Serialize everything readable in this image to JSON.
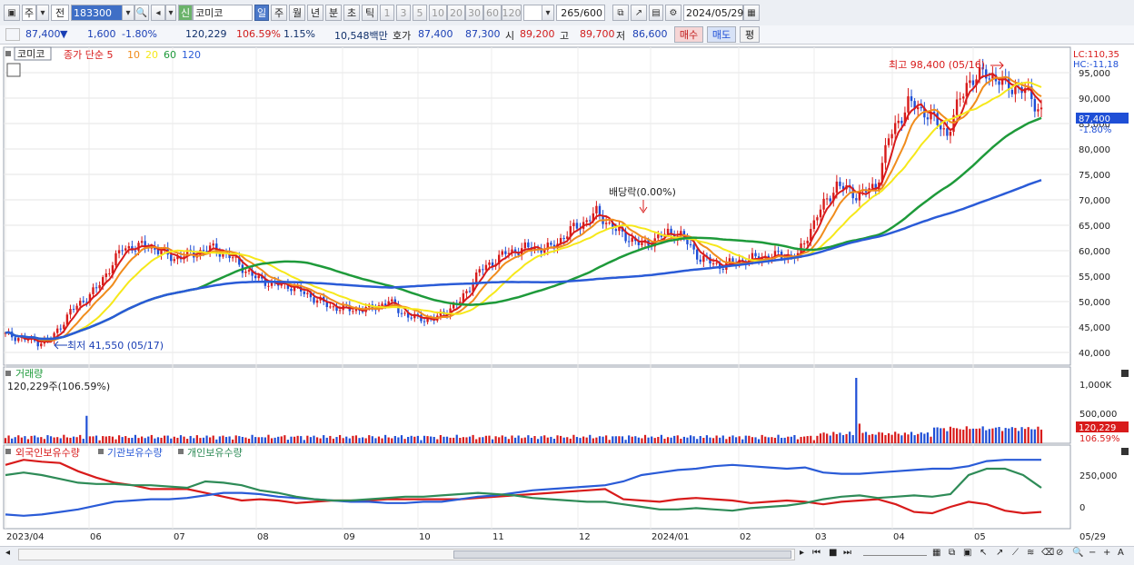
{
  "toolbar": {
    "chart_type": "주",
    "compare": "전",
    "code": "183300",
    "badge": "신",
    "name": "코미코",
    "periods": [
      "일",
      "주",
      "월",
      "년",
      "분",
      "초",
      "틱"
    ],
    "intervals": [
      "1",
      "3",
      "5",
      "10",
      "20",
      "30",
      "60",
      "120"
    ],
    "count_value": "265",
    "count_max": "/600",
    "date": "2024/05/29"
  },
  "quote": {
    "price": "87,400",
    "change": "1,600",
    "change_pct": "-1.80%",
    "volume": "120,229",
    "volume_ratio": "106.59%",
    "turnover": "1.15%",
    "amount": "10,548백만",
    "ask_label": "호가",
    "ask": "87,400",
    "bid": "87,300",
    "open_label": "시",
    "open": "89,200",
    "high_label": "고",
    "high": "89,700",
    "low_label": "저",
    "low": "86,600",
    "buy": "매수",
    "sell": "매도",
    "eval": "평"
  },
  "colors": {
    "ma5": "#d81b1b",
    "ma10": "#f08c1c",
    "ma20": "#f6e81a",
    "ma60": "#1e9a3a",
    "ma120": "#2a5bd7",
    "up": "#d81b1b",
    "down": "#1f4fd6",
    "foreign": "#d81b1b",
    "inst": "#2a5bd7",
    "indiv": "#2e8b57"
  },
  "chart_data": [
    {
      "type": "candlestick",
      "legend_name": "코미코",
      "legend_series": [
        "종가 단순 5",
        "10",
        "20",
        "60",
        "120"
      ],
      "price_labels": [
        "95,000",
        "90,000",
        "85,000",
        "80,000",
        "75,000",
        "70,000",
        "65,000",
        "60,000",
        "55,000",
        "50,000",
        "45,000",
        "40,000"
      ],
      "price_ticks": [
        95000,
        90000,
        85000,
        80000,
        75000,
        70000,
        65000,
        60000,
        55000,
        50000,
        45000,
        40000
      ],
      "ylim": [
        37500,
        100000
      ],
      "lc": "LC:110,35",
      "hc": "HC:-11,18",
      "current_price": "87,400",
      "current_pct": "-1.80%",
      "annotation_high": "최고 98,400 (05/16)",
      "annotation_low": "최저 41,550 (05/17)",
      "annotation_dividend": "배당락(0.00%)",
      "close_keypoints": [
        [
          0,
          43500
        ],
        [
          10,
          42000
        ],
        [
          14,
          42500
        ],
        [
          20,
          48000
        ],
        [
          28,
          52500
        ],
        [
          36,
          60500
        ],
        [
          44,
          61000
        ],
        [
          52,
          58500
        ],
        [
          58,
          59500
        ],
        [
          64,
          60500
        ],
        [
          70,
          58500
        ],
        [
          76,
          55000
        ],
        [
          82,
          53500
        ],
        [
          88,
          53000
        ],
        [
          94,
          51000
        ],
        [
          100,
          49000
        ],
        [
          106,
          48500
        ],
        [
          112,
          48500
        ],
        [
          118,
          50000
        ],
        [
          124,
          47000
        ],
        [
          132,
          46500
        ],
        [
          140,
          50000
        ],
        [
          146,
          56000
        ],
        [
          154,
          59500
        ],
        [
          160,
          60500
        ],
        [
          168,
          60500
        ],
        [
          174,
          64000
        ],
        [
          178,
          65500
        ],
        [
          182,
          67500
        ],
        [
          188,
          64000
        ],
        [
          196,
          61000
        ],
        [
          204,
          63500
        ],
        [
          208,
          63000
        ],
        [
          214,
          58500
        ],
        [
          220,
          57000
        ],
        [
          226,
          58000
        ],
        [
          236,
          59000
        ],
        [
          244,
          59000
        ],
        [
          250,
          67000
        ],
        [
          256,
          73000
        ],
        [
          262,
          71000
        ],
        [
          268,
          72500
        ],
        [
          272,
          82000
        ],
        [
          278,
          89000
        ],
        [
          284,
          87000
        ],
        [
          290,
          83000
        ],
        [
          296,
          93000
        ],
        [
          302,
          95000
        ],
        [
          308,
          92500
        ],
        [
          314,
          91500
        ],
        [
          319,
          87400
        ]
      ]
    },
    {
      "type": "bar",
      "legend_name": "거래량",
      "volume_label": "120,229주(106.59%)",
      "tick_labels": [
        "1,000K",
        "500,000"
      ],
      "current_volume": "120,229",
      "current_pct": "106.59%"
    },
    {
      "type": "line",
      "legend_series": [
        "외국인보유수량",
        "기관보유수량",
        "개인보유수량"
      ],
      "tick_labels": [
        "250,000",
        "0"
      ],
      "foreign_keypoints": [
        [
          0,
          330
        ],
        [
          20,
          370
        ],
        [
          40,
          355
        ],
        [
          60,
          345
        ],
        [
          80,
          280
        ],
        [
          100,
          230
        ],
        [
          120,
          190
        ],
        [
          140,
          170
        ],
        [
          160,
          140
        ],
        [
          180,
          140
        ],
        [
          200,
          140
        ],
        [
          220,
          110
        ],
        [
          240,
          80
        ],
        [
          260,
          50
        ],
        [
          280,
          60
        ],
        [
          300,
          50
        ],
        [
          320,
          30
        ],
        [
          340,
          40
        ],
        [
          360,
          50
        ],
        [
          380,
          50
        ],
        [
          400,
          50
        ],
        [
          420,
          60
        ],
        [
          440,
          60
        ],
        [
          460,
          60
        ],
        [
          480,
          60
        ],
        [
          500,
          60
        ],
        [
          520,
          70
        ],
        [
          540,
          80
        ],
        [
          560,
          90
        ],
        [
          580,
          100
        ],
        [
          600,
          110
        ],
        [
          620,
          120
        ],
        [
          640,
          130
        ],
        [
          660,
          140
        ],
        [
          680,
          60
        ],
        [
          700,
          50
        ],
        [
          720,
          40
        ],
        [
          740,
          60
        ],
        [
          760,
          70
        ],
        [
          780,
          60
        ],
        [
          800,
          50
        ],
        [
          820,
          30
        ],
        [
          840,
          40
        ],
        [
          860,
          50
        ],
        [
          880,
          40
        ],
        [
          900,
          20
        ],
        [
          920,
          40
        ],
        [
          940,
          50
        ],
        [
          960,
          60
        ],
        [
          980,
          20
        ],
        [
          1000,
          -40
        ],
        [
          1020,
          -50
        ],
        [
          1040,
          0
        ],
        [
          1060,
          40
        ],
        [
          1080,
          20
        ],
        [
          1100,
          -30
        ],
        [
          1120,
          -50
        ],
        [
          1140,
          -40
        ]
      ],
      "inst_keypoints": [
        [
          0,
          -60
        ],
        [
          20,
          -70
        ],
        [
          40,
          -60
        ],
        [
          60,
          -40
        ],
        [
          80,
          -20
        ],
        [
          100,
          10
        ],
        [
          120,
          40
        ],
        [
          140,
          50
        ],
        [
          160,
          60
        ],
        [
          180,
          60
        ],
        [
          200,
          70
        ],
        [
          220,
          90
        ],
        [
          240,
          110
        ],
        [
          260,
          110
        ],
        [
          280,
          100
        ],
        [
          300,
          80
        ],
        [
          320,
          70
        ],
        [
          340,
          60
        ],
        [
          360,
          50
        ],
        [
          380,
          40
        ],
        [
          400,
          40
        ],
        [
          420,
          30
        ],
        [
          440,
          30
        ],
        [
          460,
          40
        ],
        [
          480,
          40
        ],
        [
          500,
          60
        ],
        [
          520,
          80
        ],
        [
          540,
          90
        ],
        [
          560,
          110
        ],
        [
          580,
          130
        ],
        [
          600,
          140
        ],
        [
          620,
          150
        ],
        [
          640,
          160
        ],
        [
          660,
          170
        ],
        [
          680,
          200
        ],
        [
          700,
          250
        ],
        [
          720,
          270
        ],
        [
          740,
          290
        ],
        [
          760,
          300
        ],
        [
          780,
          320
        ],
        [
          800,
          330
        ],
        [
          820,
          320
        ],
        [
          840,
          310
        ],
        [
          860,
          300
        ],
        [
          880,
          310
        ],
        [
          900,
          270
        ],
        [
          920,
          260
        ],
        [
          940,
          260
        ],
        [
          960,
          270
        ],
        [
          980,
          280
        ],
        [
          1000,
          290
        ],
        [
          1020,
          300
        ],
        [
          1040,
          300
        ],
        [
          1060,
          320
        ],
        [
          1080,
          360
        ],
        [
          1100,
          370
        ],
        [
          1120,
          370
        ],
        [
          1140,
          370
        ]
      ],
      "indiv_keypoints": [
        [
          0,
          250
        ],
        [
          20,
          270
        ],
        [
          40,
          250
        ],
        [
          60,
          220
        ],
        [
          80,
          190
        ],
        [
          100,
          180
        ],
        [
          120,
          180
        ],
        [
          140,
          170
        ],
        [
          160,
          170
        ],
        [
          180,
          160
        ],
        [
          200,
          150
        ],
        [
          220,
          200
        ],
        [
          240,
          190
        ],
        [
          260,
          170
        ],
        [
          280,
          130
        ],
        [
          300,
          110
        ],
        [
          320,
          80
        ],
        [
          340,
          60
        ],
        [
          360,
          50
        ],
        [
          380,
          50
        ],
        [
          400,
          60
        ],
        [
          420,
          70
        ],
        [
          440,
          80
        ],
        [
          460,
          80
        ],
        [
          480,
          90
        ],
        [
          500,
          100
        ],
        [
          520,
          110
        ],
        [
          540,
          100
        ],
        [
          560,
          90
        ],
        [
          580,
          70
        ],
        [
          600,
          60
        ],
        [
          620,
          50
        ],
        [
          640,
          40
        ],
        [
          660,
          40
        ],
        [
          680,
          20
        ],
        [
          700,
          0
        ],
        [
          720,
          -20
        ],
        [
          740,
          -20
        ],
        [
          760,
          -10
        ],
        [
          780,
          -20
        ],
        [
          800,
          -30
        ],
        [
          820,
          -10
        ],
        [
          840,
          0
        ],
        [
          860,
          10
        ],
        [
          880,
          30
        ],
        [
          900,
          60
        ],
        [
          920,
          80
        ],
        [
          940,
          90
        ],
        [
          960,
          70
        ],
        [
          980,
          80
        ],
        [
          1000,
          90
        ],
        [
          1020,
          80
        ],
        [
          1040,
          100
        ],
        [
          1060,
          250
        ],
        [
          1080,
          300
        ],
        [
          1100,
          300
        ],
        [
          1120,
          250
        ],
        [
          1140,
          150
        ]
      ]
    }
  ],
  "x_axis": {
    "labels": [
      "2023/04",
      "06",
      "07",
      "08",
      "09",
      "10",
      "11",
      "12",
      "2024/01",
      "02",
      "03",
      "04",
      "05"
    ],
    "end_label": "05/29"
  }
}
